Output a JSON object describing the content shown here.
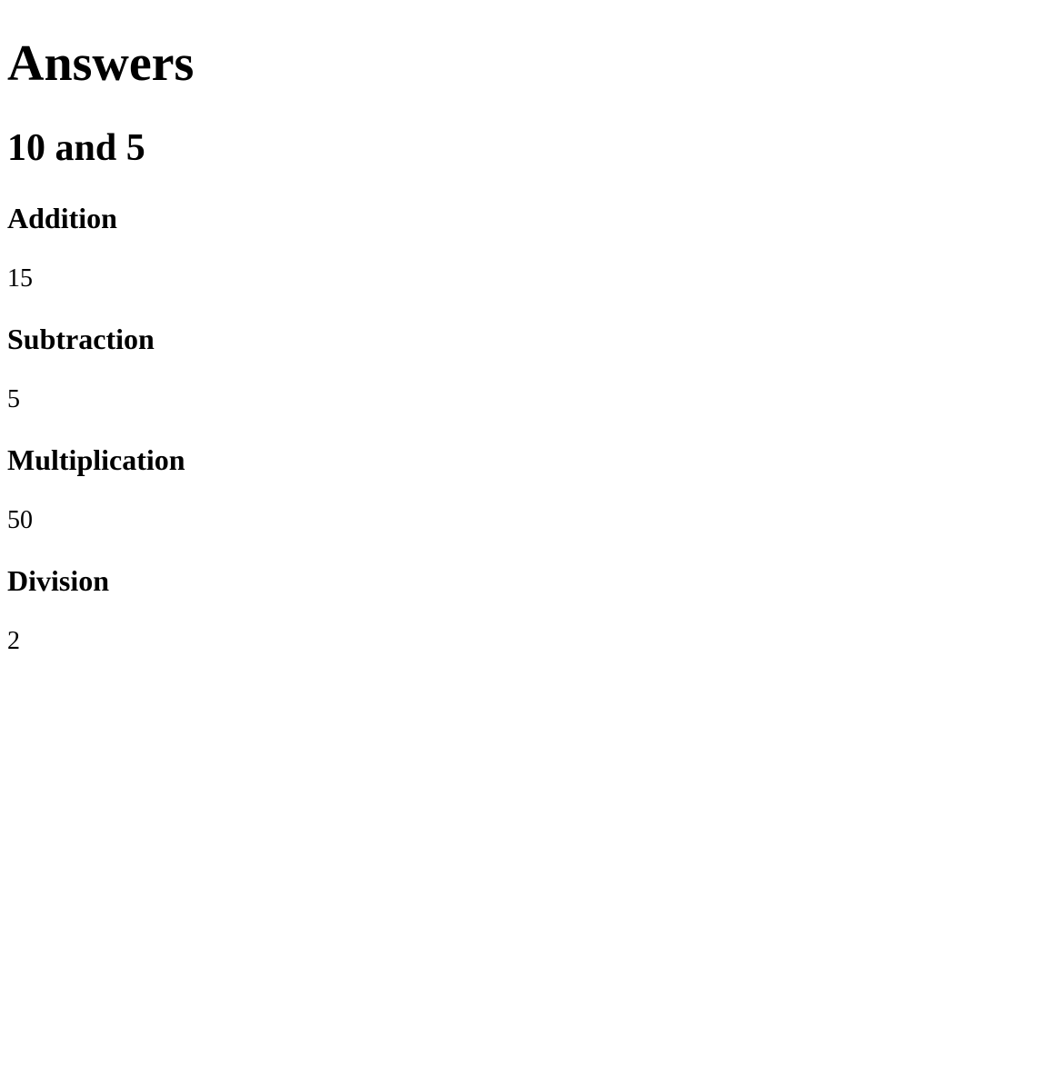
{
  "title": "Answers",
  "subtitle": "10 and 5",
  "sections": {
    "addition": {
      "label": "Addition",
      "value": "15"
    },
    "subtraction": {
      "label": "Subtraction",
      "value": "5"
    },
    "multiplication": {
      "label": "Multiplication",
      "value": "50"
    },
    "division": {
      "label": "Division",
      "value": "2"
    }
  }
}
